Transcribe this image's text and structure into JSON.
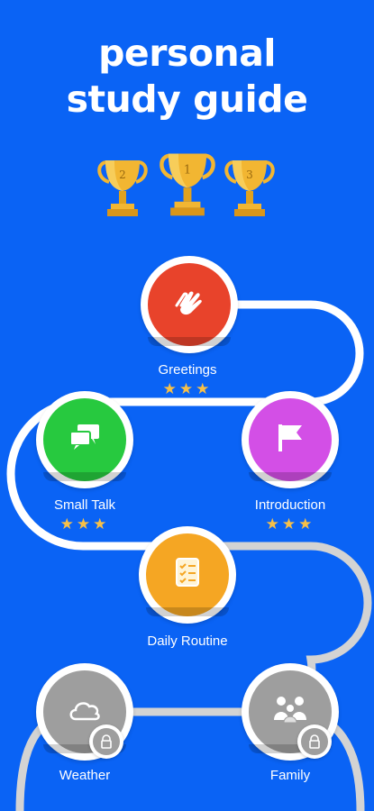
{
  "headline": {
    "line1": "personal",
    "line2": "study guide"
  },
  "trophies": [
    {
      "rank": "2",
      "icon": "trophy-icon"
    },
    {
      "rank": "1",
      "icon": "trophy-icon"
    },
    {
      "rank": "3",
      "icon": "trophy-icon"
    }
  ],
  "lessons": [
    {
      "label": "Greetings",
      "stars": "★★★",
      "color": "#e8432b",
      "icon": "clapping-hands-icon",
      "locked": false
    },
    {
      "label": "Small Talk",
      "stars": "★★★",
      "color": "#27c93f",
      "icon": "chat-bubbles-icon",
      "locked": false
    },
    {
      "label": "Introduction",
      "stars": "★★★",
      "color": "#d34fe6",
      "icon": "flag-icon",
      "locked": false
    },
    {
      "label": "Daily Routine",
      "stars": "",
      "color": "#f5a623",
      "icon": "checklist-icon",
      "locked": false
    },
    {
      "label": "Weather",
      "stars": "",
      "color": "#9e9e9e",
      "icon": "cloud-icon",
      "locked": true
    },
    {
      "label": "Family",
      "stars": "",
      "color": "#9e9e9e",
      "icon": "family-icon",
      "locked": true
    }
  ],
  "colors": {
    "background": "#0a63f5",
    "star": "#f7c048",
    "trophy": "#f2b632",
    "path_done": "#ffffff",
    "path_locked": "#d3d3d3"
  }
}
